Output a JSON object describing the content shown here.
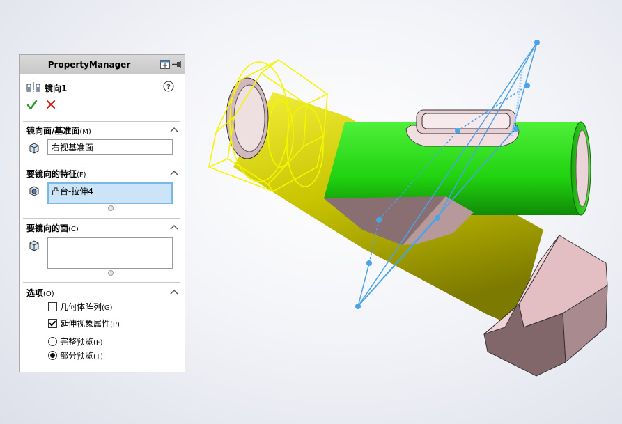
{
  "property_manager": {
    "header_title": "PropertyManager",
    "feature_name": "镜向1",
    "mirror_face": {
      "title": "镜向面/基准面",
      "shortcut": "(M)",
      "value": "右视基准面"
    },
    "features_to_mirror": {
      "title": "要镜向的特征",
      "shortcut": "(F)",
      "value": "凸台-拉伸4"
    },
    "faces_to_mirror": {
      "title": "要镜向的面",
      "shortcut": "(C)",
      "value": ""
    },
    "options": {
      "title": "选项",
      "shortcut": "(O)",
      "geometry_pattern": {
        "label": "几何体阵列",
        "shortcut": "(G)",
        "checked": false
      },
      "propagate_visual": {
        "label": "延伸视象属性",
        "shortcut": "(P)",
        "checked": true
      },
      "full_preview": {
        "label": "完整预览",
        "shortcut": "(F)",
        "selected": false
      },
      "partial_preview": {
        "label": "部分预览",
        "shortcut": "(T)",
        "selected": true
      }
    }
  },
  "colors": {
    "pipe_yellow": "#c8c400",
    "pipe_green": "#20d20f",
    "nut_pink": "#e6c3c8",
    "plane_blue": "#4aa3e8",
    "preview_yellow": "#f5f500"
  }
}
